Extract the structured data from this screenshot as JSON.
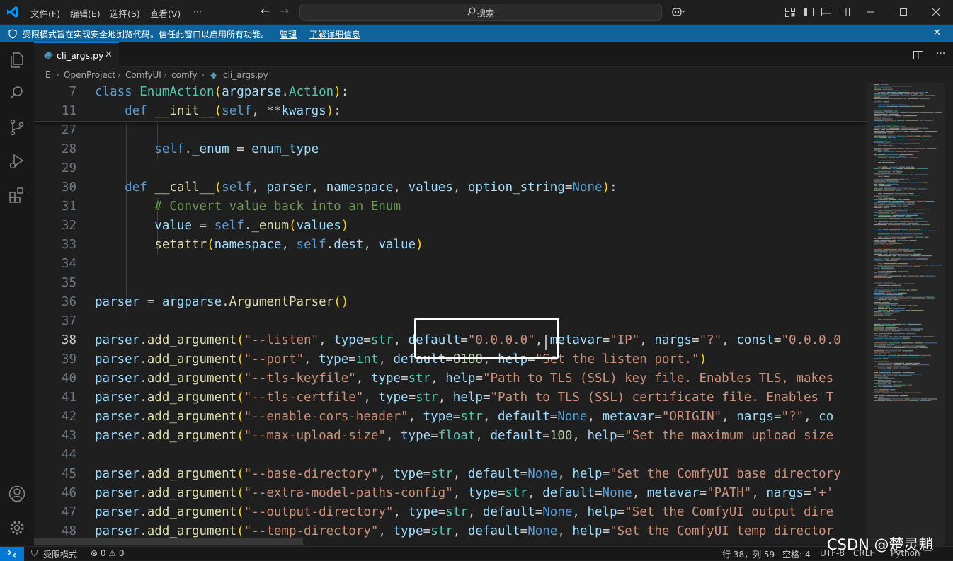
{
  "titlebar": {
    "menus": [
      "文件(F)",
      "编辑(E)",
      "选择(S)",
      "查看(V)",
      "···"
    ],
    "search_label": "搜索"
  },
  "banner": {
    "text": "受限模式旨在实现安全地浏览代码。信任此窗口以启用所有功能。",
    "manage_link": "管理",
    "learn_more_link": "了解详细信息",
    "close": "✕"
  },
  "tab": {
    "label": "cli_args.py",
    "close": "✕"
  },
  "breadcrumb": [
    "E:",
    "OpenProject",
    "ComfyUI",
    "comfy",
    "cli_args.py"
  ],
  "editor": {
    "lines": [
      {
        "n": "7",
        "t": "class EnumAction(argparse.Action):"
      },
      {
        "n": "11",
        "t": "    def __init__(self, **kwargs):"
      },
      {
        "n": "27",
        "t": ""
      },
      {
        "n": "28",
        "t": "        self._enum = enum_type"
      },
      {
        "n": "29",
        "t": ""
      },
      {
        "n": "30",
        "t": "    def __call__(self, parser, namespace, values, option_string=None):"
      },
      {
        "n": "31",
        "t": "        # Convert value back into an Enum"
      },
      {
        "n": "32",
        "t": "        value = self._enum(values)"
      },
      {
        "n": "33",
        "t": "        setattr(namespace, self.dest, value)"
      },
      {
        "n": "34",
        "t": ""
      },
      {
        "n": "35",
        "t": ""
      },
      {
        "n": "36",
        "t": "parser = argparse.ArgumentParser()"
      },
      {
        "n": "37",
        "t": ""
      },
      {
        "n": "38",
        "t": "parser.add_argument(\"--listen\", type=str, default=\"0.0.0.0\", metavar=\"IP\", nargs=\"?\", const=\"0.0.0.0"
      },
      {
        "n": "39",
        "t": "parser.add_argument(\"--port\", type=int, default=8188, help=\"Set the listen port.\")"
      },
      {
        "n": "40",
        "t": "parser.add_argument(\"--tls-keyfile\", type=str, help=\"Path to TLS (SSL) key file. Enables TLS, makes"
      },
      {
        "n": "41",
        "t": "parser.add_argument(\"--tls-certfile\", type=str, help=\"Path to TLS (SSL) certificate file. Enables T"
      },
      {
        "n": "42",
        "t": "parser.add_argument(\"--enable-cors-header\", type=str, default=None, metavar=\"ORIGIN\", nargs=\"?\", co"
      },
      {
        "n": "43",
        "t": "parser.add_argument(\"--max-upload-size\", type=float, default=100, help=\"Set the maximum upload size"
      },
      {
        "n": "44",
        "t": ""
      },
      {
        "n": "45",
        "t": "parser.add_argument(\"--base-directory\", type=str, default=None, help=\"Set the ComfyUI base directory"
      },
      {
        "n": "46",
        "t": "parser.add_argument(\"--extra-model-paths-config\", type=str, default=None, metavar=\"PATH\", nargs='+'"
      },
      {
        "n": "47",
        "t": "parser.add_argument(\"--output-directory\", type=str, default=None, help=\"Set the ComfyUI output dire"
      },
      {
        "n": "48",
        "t": "parser.add_argument(\"--temp-directory\", type=str, default=None, help=\"Set the ComfyUI temp director"
      }
    ],
    "current_line": "38"
  },
  "statusbar": {
    "restricted": "受限模式",
    "problems": "⊗ 0 ⚠ 0",
    "position": "行 38，列 59",
    "indent": "空格: 4",
    "encoding": "UTF-8",
    "eol": "CRLF",
    "language": "Python"
  },
  "watermark": "CSDN @楚灵魈",
  "colors": {
    "accent": "#0078d4",
    "banner": "#0e639c"
  }
}
